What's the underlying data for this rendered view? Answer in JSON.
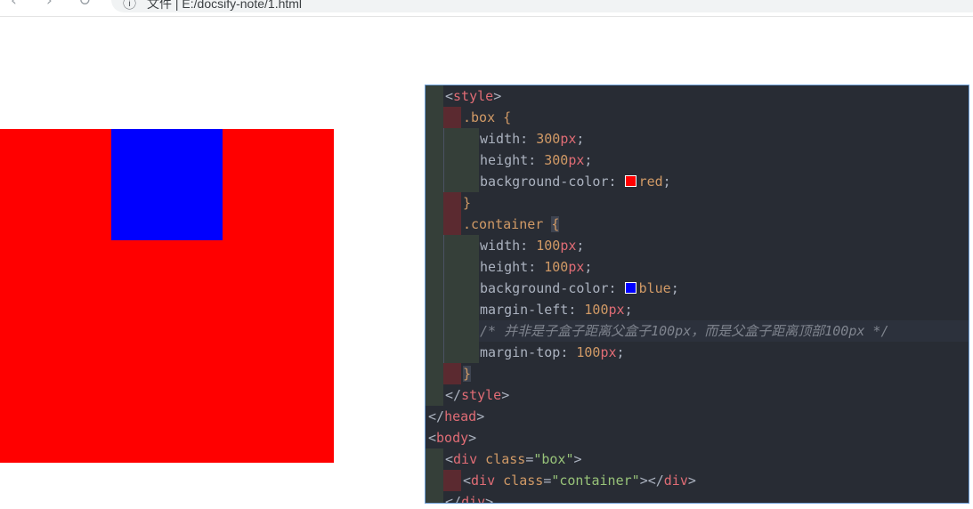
{
  "browser": {
    "back_icon": "back-arrow-icon",
    "forward_icon": "forward-arrow-icon",
    "reload_icon": "reload-icon",
    "info_icon": "info-icon",
    "address_label": "文件",
    "address_separator": "|",
    "address_path": "E:/docsify-note/1.html"
  },
  "page": {
    "box_color": "#ff0000",
    "container_color": "#0000ff"
  },
  "editor": {
    "lines": {
      "l1": {
        "tag": "style"
      },
      "l2": {
        "selector": ".box",
        "brace": "{"
      },
      "l3": {
        "prop": "width",
        "num": "300",
        "unit": "px"
      },
      "l4": {
        "prop": "height",
        "num": "300",
        "unit": "px"
      },
      "l5": {
        "prop": "background-color",
        "value": "red",
        "swatch": "#ff0000"
      },
      "l6": {
        "brace": "}"
      },
      "l7": {
        "selector": ".container",
        "brace": "{"
      },
      "l8": {
        "prop": "width",
        "num": "100",
        "unit": "px"
      },
      "l9": {
        "prop": "height",
        "num": "100",
        "unit": "px"
      },
      "l10": {
        "prop": "background-color",
        "value": "blue",
        "swatch": "#0000ff"
      },
      "l11": {
        "prop": "margin-left",
        "num": "100",
        "unit": "px"
      },
      "l12": {
        "comment": "/* 并非是子盒子距离父盒子100px，而是父盒子距离顶部100px */"
      },
      "l13": {
        "prop": "margin-top",
        "num": "100",
        "unit": "px"
      },
      "l14": {
        "brace": "}"
      },
      "l15": {
        "tag": "style"
      },
      "l16": {
        "tag": "head"
      },
      "l17": {
        "tag": "body"
      },
      "l18": {
        "tag": "div",
        "attr": "class",
        "value": "\"box\""
      },
      "l19": {
        "tag": "div",
        "attr": "class",
        "value": "\"container\"",
        "close_tag": "div"
      },
      "l20": {
        "tag": "div"
      }
    },
    "colors": {
      "background": "#282c34",
      "tag": "#e06c75",
      "number": "#d19a66",
      "string": "#98c379",
      "comment": "#7f848e"
    }
  }
}
